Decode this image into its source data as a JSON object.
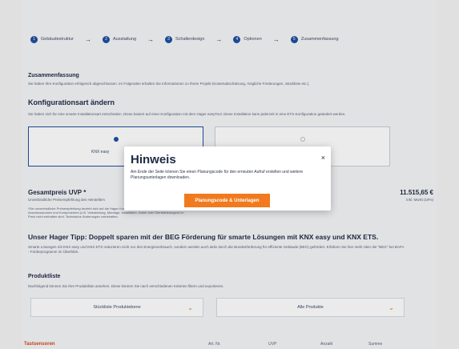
{
  "stepper": {
    "steps": [
      {
        "num": "1",
        "label": "Gebäudestruktur"
      },
      {
        "num": "2",
        "label": "Ausstattung"
      },
      {
        "num": "3",
        "label": "Schalterdesign"
      },
      {
        "num": "4",
        "label": "Optionen"
      },
      {
        "num": "5",
        "label": "Zusammenfassung"
      }
    ],
    "arrow": "→"
  },
  "summary": {
    "title": "Zusammenfassung",
    "text": "Sie haben Ihre Konfiguration erfolgreich abgeschlossen. Im Folgenden erhalten Sie Informationen zu Ihrem Projekt (Kostenabschätzung, mögliche Förderungen, Stückliste etc.)."
  },
  "config": {
    "title": "Konfigurationsart ändern",
    "text": "Sie haben sich für eine smarte Installationsart entschieden. Diese basiert auf einer Konfiguration mit dem Hager easyTool. Diese Installation kann jederzeit in eine ETS-Konfiguration geändert werden.",
    "card_left_text": "KNX easy"
  },
  "price": {
    "label": "Gesamtpreis UVP *",
    "sub_text": "Unverbindliche Preisempfehlung des Herstellers",
    "note": "*Die unverbindliche Preisempfehlung bezieht sich auf die Hager Komponenten. Preise für weitere Anschlusskosten und Komponenten (z.B. Verkabelung, Montage, Installation, Kabel oder Dienstleistungen) im Preis nicht enthalten sind. Technische Änderungen vorbehalten.",
    "value": "11.515,65 €",
    "value_sub": "inkl. MwSt (19%)"
  },
  "tip": {
    "title": "Unser Hager Tipp: Doppelt sparen mit der BEG Förderung für smarte Lösungen mit KNX easy und KNX ETS.",
    "text": "Smarte Lösungen mit KNX easy und KNX ETS reduzieren nicht nur den Energieverbrauch, sondern werden auch aktiv durch die Bundesförderung für effiziente Gebäude (BEG) gefördert. Erfahren Sie hier mehr über die \"BEG\" bei BAFA - Förderprogramm im Überblick."
  },
  "products": {
    "title": "Produktliste",
    "text": "Nachfolgend können Sie Ihre Produktliste ansehen. Diese können Sie nach verschiedenen Kriterien filtern und exportieren.",
    "dropdown_left": "Stückliste Produktebene",
    "dropdown_right": "Alle Produkte"
  },
  "table": {
    "first": "Tastsensoren",
    "cols": [
      "Art. Nr.",
      "UVP",
      "Anzahl",
      "Summe"
    ]
  },
  "modal": {
    "title": "Hinweis",
    "text": "Am Ende der Seite können Sie einen Planungscode für den erneuten Aufruf erstellen und weitere Planungsunterlagen downloaden.",
    "button": "Planungscode & Unterlagen",
    "close": "×"
  },
  "colors": {
    "accent": "#f07a1d",
    "primary": "#1f4fa0"
  }
}
